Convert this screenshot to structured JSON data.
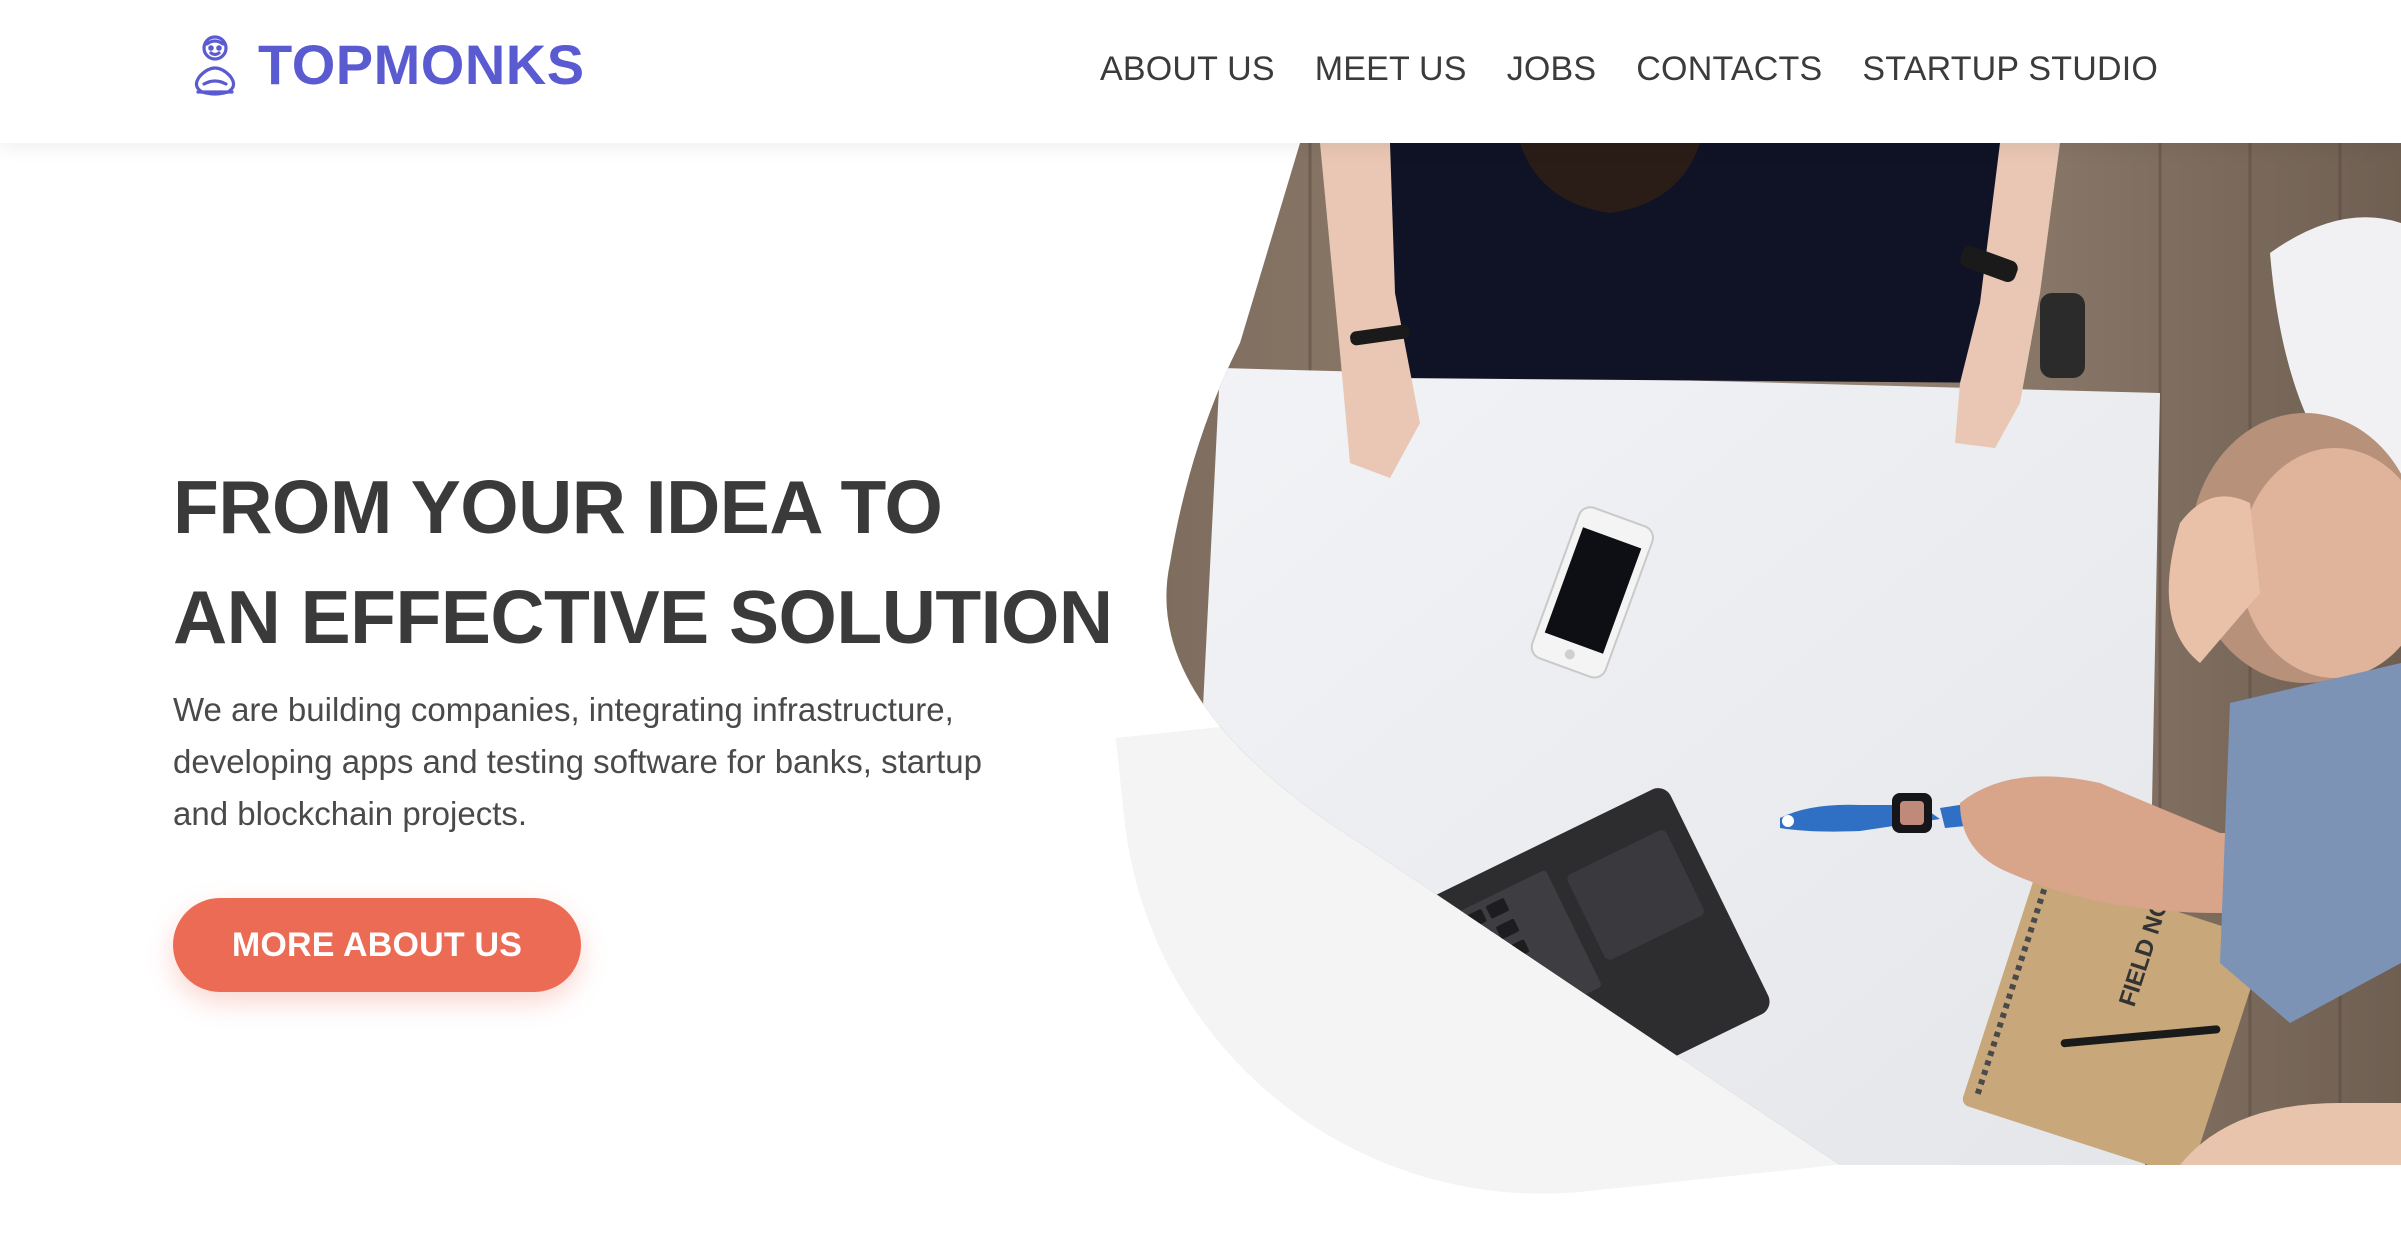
{
  "brand": {
    "name": "TOPMONKS",
    "color": "#5b5bd1",
    "logo_icon": "monk-icon"
  },
  "nav": {
    "items": [
      {
        "label": "ABOUT US"
      },
      {
        "label": "MEET US"
      },
      {
        "label": "JOBS"
      },
      {
        "label": "CONTACTS"
      },
      {
        "label": "STARTUP STUDIO"
      }
    ]
  },
  "hero": {
    "title_line1": "FROM YOUR IDEA TO",
    "title_line2": "AN EFFECTIVE SOLUTION",
    "description_line1": "We are building companies, integrating infrastructure,",
    "description_line2": "developing apps and testing software for banks, startup",
    "description_line3": "and blockchain projects.",
    "cta_label": "MORE ABOUT US",
    "cta_color": "#ec6b55",
    "image": "team-working-at-table-photo",
    "notebook_text": "FIELD NOTES"
  }
}
